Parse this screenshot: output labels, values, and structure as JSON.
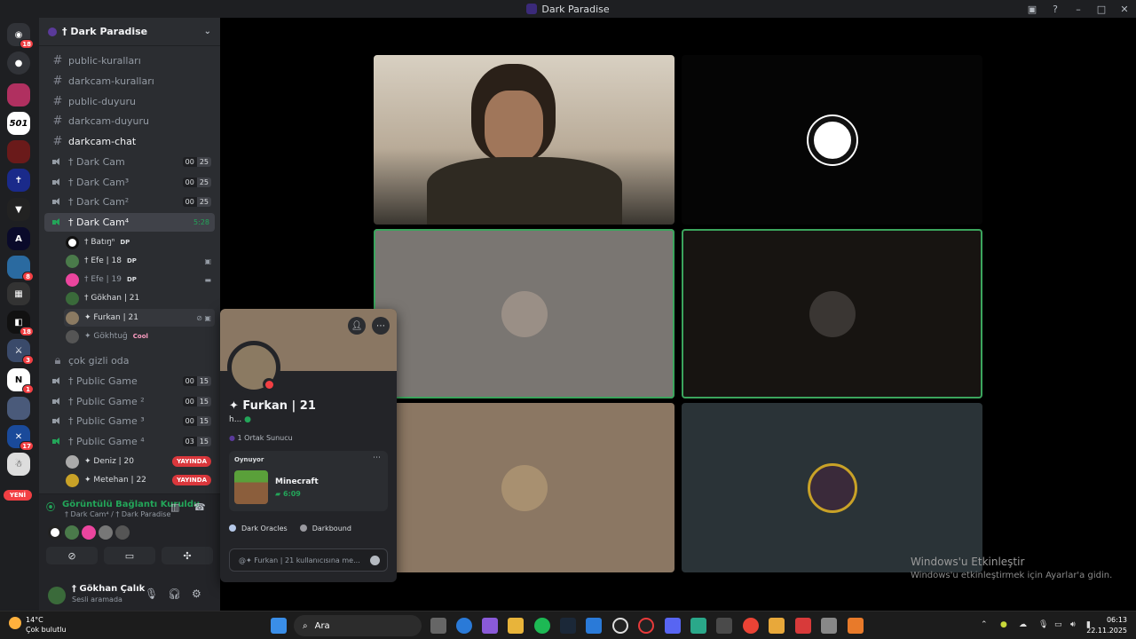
{
  "window": {
    "title": "Dark Paradise"
  },
  "rail": {
    "badges": [
      "18",
      "8",
      "18",
      "3",
      "1",
      "17"
    ],
    "new_label": "YENİ"
  },
  "guild": {
    "name": "† Dark Paradise"
  },
  "channels": {
    "text": [
      "public-kuralları",
      "darkcam-kuralları",
      "public-duyuru",
      "darkcam-duyuru",
      "darkcam-chat"
    ],
    "voice": [
      {
        "name": "† Dark Cam",
        "limit_a": "00",
        "limit_b": "25"
      },
      {
        "name": "† Dark Cam³",
        "limit_a": "00",
        "limit_b": "25"
      },
      {
        "name": "† Dark Cam²",
        "limit_a": "00",
        "limit_b": "25"
      },
      {
        "name": "† Dark Cam⁴",
        "timer": "5:28"
      }
    ],
    "members": [
      {
        "name": "† Batıŋⁿ",
        "tag": "DP"
      },
      {
        "name": "† Efe | 18",
        "tag": "DP"
      },
      {
        "name": "† Efe | 19",
        "tag": "DP"
      },
      {
        "name": "† Gökhan | 21"
      },
      {
        "name": "✦ Furkan | 21"
      },
      {
        "name": "✦ Gökhtuğ",
        "tag": "Cool"
      }
    ],
    "locked": "çok gizli oda",
    "public": [
      {
        "name": "† Public Game",
        "limit_a": "00",
        "limit_b": "15"
      },
      {
        "name": "† Public Game ²",
        "limit_a": "00",
        "limit_b": "15"
      },
      {
        "name": "† Public Game ³",
        "limit_a": "00",
        "limit_b": "15"
      },
      {
        "name": "† Public Game ⁴",
        "limit_a": "03",
        "limit_b": "15"
      }
    ],
    "streamers": [
      {
        "name": "✦ Deniz | 20",
        "live": "YAYINDA"
      },
      {
        "name": "✦ Metehan | 22",
        "live": "YAYINDA"
      }
    ]
  },
  "voice_panel": {
    "status": "Görüntülü Bağlantı Kuruldu",
    "location": "† Dark Cam⁴ / † Dark Paradise"
  },
  "user_panel": {
    "name": "† Gökhan Çalık",
    "status": "Sesli aramada"
  },
  "popout": {
    "name": "✦ Furkan | 21",
    "handle": "h...",
    "mutual": "1 Ortak Sunucu",
    "activity_label": "Oynuyor",
    "game": "Minecraft",
    "game_time": "6:09",
    "roles": [
      "Dark Oracles",
      "Darkbound"
    ],
    "message_placeholder": "@✦ Furkan | 21 kullanıcısına me..."
  },
  "watermark": {
    "title": "Windows'u Etkinleştir",
    "subtitle": "Windows'u etkinleştirmek için Ayarlar'a gidin."
  },
  "taskbar": {
    "weather_temp": "14°C",
    "weather_desc": "Çok bulutlu",
    "search": "Ara",
    "time": "06:13",
    "date": "22.11.2025"
  }
}
